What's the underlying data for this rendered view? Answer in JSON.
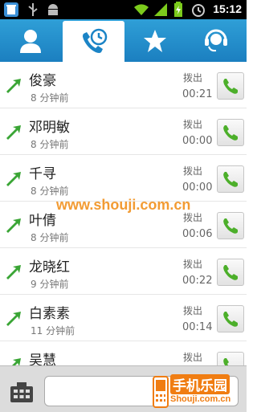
{
  "status": {
    "time": "15:12"
  },
  "tabs": [
    {
      "icon": "person-icon"
    },
    {
      "icon": "call-log-icon",
      "selected": true
    },
    {
      "icon": "star-icon"
    },
    {
      "icon": "headset-icon"
    }
  ],
  "calls": [
    {
      "name": "俊豪",
      "ago": "8 分钟前",
      "type": "拨出",
      "duration": "00:21"
    },
    {
      "name": "邓明敏",
      "ago": "8 分钟前",
      "type": "拨出",
      "duration": "00:00"
    },
    {
      "name": "千寻",
      "ago": "8 分钟前",
      "type": "拨出",
      "duration": "00:00"
    },
    {
      "name": "叶倩",
      "ago": "8 分钟前",
      "type": "拨出",
      "duration": "00:06"
    },
    {
      "name": "龙晓红",
      "ago": "9 分钟前",
      "type": "拨出",
      "duration": "00:22"
    },
    {
      "name": "白素素",
      "ago": "11 分钟前",
      "type": "拨出",
      "duration": "00:14"
    },
    {
      "name": "吴慧",
      "ago": "",
      "type": "拨出",
      "duration": ""
    }
  ],
  "watermark": "www.shouji.com.cn",
  "logo": {
    "top": "手机乐园",
    "bottom": "Shouji.com.cn"
  }
}
